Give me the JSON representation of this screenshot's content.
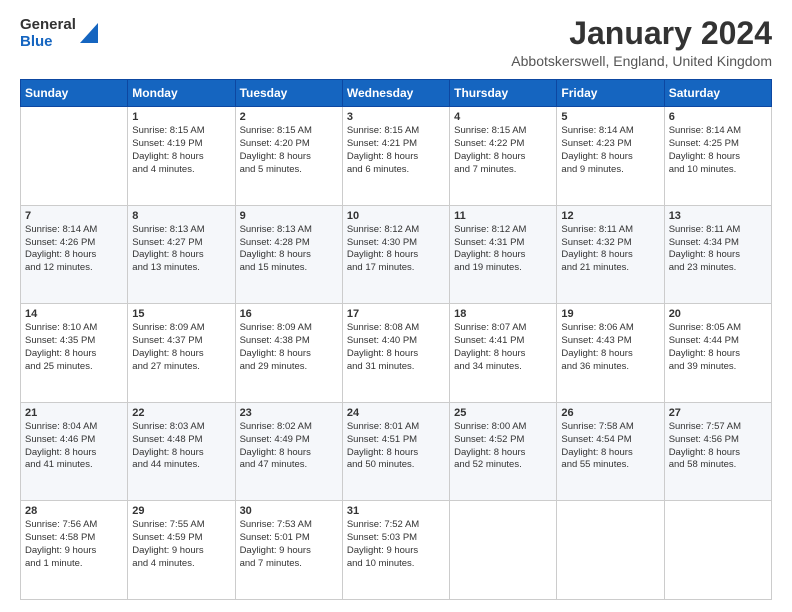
{
  "logo": {
    "line1": "General",
    "line2": "Blue"
  },
  "header": {
    "title": "January 2024",
    "subtitle": "Abbotskerswell, England, United Kingdom"
  },
  "weekdays": [
    "Sunday",
    "Monday",
    "Tuesday",
    "Wednesday",
    "Thursday",
    "Friday",
    "Saturday"
  ],
  "weeks": [
    [
      {
        "day": "",
        "lines": []
      },
      {
        "day": "1",
        "lines": [
          "Sunrise: 8:15 AM",
          "Sunset: 4:19 PM",
          "Daylight: 8 hours",
          "and 4 minutes."
        ]
      },
      {
        "day": "2",
        "lines": [
          "Sunrise: 8:15 AM",
          "Sunset: 4:20 PM",
          "Daylight: 8 hours",
          "and 5 minutes."
        ]
      },
      {
        "day": "3",
        "lines": [
          "Sunrise: 8:15 AM",
          "Sunset: 4:21 PM",
          "Daylight: 8 hours",
          "and 6 minutes."
        ]
      },
      {
        "day": "4",
        "lines": [
          "Sunrise: 8:15 AM",
          "Sunset: 4:22 PM",
          "Daylight: 8 hours",
          "and 7 minutes."
        ]
      },
      {
        "day": "5",
        "lines": [
          "Sunrise: 8:14 AM",
          "Sunset: 4:23 PM",
          "Daylight: 8 hours",
          "and 9 minutes."
        ]
      },
      {
        "day": "6",
        "lines": [
          "Sunrise: 8:14 AM",
          "Sunset: 4:25 PM",
          "Daylight: 8 hours",
          "and 10 minutes."
        ]
      }
    ],
    [
      {
        "day": "7",
        "lines": [
          "Sunrise: 8:14 AM",
          "Sunset: 4:26 PM",
          "Daylight: 8 hours",
          "and 12 minutes."
        ]
      },
      {
        "day": "8",
        "lines": [
          "Sunrise: 8:13 AM",
          "Sunset: 4:27 PM",
          "Daylight: 8 hours",
          "and 13 minutes."
        ]
      },
      {
        "day": "9",
        "lines": [
          "Sunrise: 8:13 AM",
          "Sunset: 4:28 PM",
          "Daylight: 8 hours",
          "and 15 minutes."
        ]
      },
      {
        "day": "10",
        "lines": [
          "Sunrise: 8:12 AM",
          "Sunset: 4:30 PM",
          "Daylight: 8 hours",
          "and 17 minutes."
        ]
      },
      {
        "day": "11",
        "lines": [
          "Sunrise: 8:12 AM",
          "Sunset: 4:31 PM",
          "Daylight: 8 hours",
          "and 19 minutes."
        ]
      },
      {
        "day": "12",
        "lines": [
          "Sunrise: 8:11 AM",
          "Sunset: 4:32 PM",
          "Daylight: 8 hours",
          "and 21 minutes."
        ]
      },
      {
        "day": "13",
        "lines": [
          "Sunrise: 8:11 AM",
          "Sunset: 4:34 PM",
          "Daylight: 8 hours",
          "and 23 minutes."
        ]
      }
    ],
    [
      {
        "day": "14",
        "lines": [
          "Sunrise: 8:10 AM",
          "Sunset: 4:35 PM",
          "Daylight: 8 hours",
          "and 25 minutes."
        ]
      },
      {
        "day": "15",
        "lines": [
          "Sunrise: 8:09 AM",
          "Sunset: 4:37 PM",
          "Daylight: 8 hours",
          "and 27 minutes."
        ]
      },
      {
        "day": "16",
        "lines": [
          "Sunrise: 8:09 AM",
          "Sunset: 4:38 PM",
          "Daylight: 8 hours",
          "and 29 minutes."
        ]
      },
      {
        "day": "17",
        "lines": [
          "Sunrise: 8:08 AM",
          "Sunset: 4:40 PM",
          "Daylight: 8 hours",
          "and 31 minutes."
        ]
      },
      {
        "day": "18",
        "lines": [
          "Sunrise: 8:07 AM",
          "Sunset: 4:41 PM",
          "Daylight: 8 hours",
          "and 34 minutes."
        ]
      },
      {
        "day": "19",
        "lines": [
          "Sunrise: 8:06 AM",
          "Sunset: 4:43 PM",
          "Daylight: 8 hours",
          "and 36 minutes."
        ]
      },
      {
        "day": "20",
        "lines": [
          "Sunrise: 8:05 AM",
          "Sunset: 4:44 PM",
          "Daylight: 8 hours",
          "and 39 minutes."
        ]
      }
    ],
    [
      {
        "day": "21",
        "lines": [
          "Sunrise: 8:04 AM",
          "Sunset: 4:46 PM",
          "Daylight: 8 hours",
          "and 41 minutes."
        ]
      },
      {
        "day": "22",
        "lines": [
          "Sunrise: 8:03 AM",
          "Sunset: 4:48 PM",
          "Daylight: 8 hours",
          "and 44 minutes."
        ]
      },
      {
        "day": "23",
        "lines": [
          "Sunrise: 8:02 AM",
          "Sunset: 4:49 PM",
          "Daylight: 8 hours",
          "and 47 minutes."
        ]
      },
      {
        "day": "24",
        "lines": [
          "Sunrise: 8:01 AM",
          "Sunset: 4:51 PM",
          "Daylight: 8 hours",
          "and 50 minutes."
        ]
      },
      {
        "day": "25",
        "lines": [
          "Sunrise: 8:00 AM",
          "Sunset: 4:52 PM",
          "Daylight: 8 hours",
          "and 52 minutes."
        ]
      },
      {
        "day": "26",
        "lines": [
          "Sunrise: 7:58 AM",
          "Sunset: 4:54 PM",
          "Daylight: 8 hours",
          "and 55 minutes."
        ]
      },
      {
        "day": "27",
        "lines": [
          "Sunrise: 7:57 AM",
          "Sunset: 4:56 PM",
          "Daylight: 8 hours",
          "and 58 minutes."
        ]
      }
    ],
    [
      {
        "day": "28",
        "lines": [
          "Sunrise: 7:56 AM",
          "Sunset: 4:58 PM",
          "Daylight: 9 hours",
          "and 1 minute."
        ]
      },
      {
        "day": "29",
        "lines": [
          "Sunrise: 7:55 AM",
          "Sunset: 4:59 PM",
          "Daylight: 9 hours",
          "and 4 minutes."
        ]
      },
      {
        "day": "30",
        "lines": [
          "Sunrise: 7:53 AM",
          "Sunset: 5:01 PM",
          "Daylight: 9 hours",
          "and 7 minutes."
        ]
      },
      {
        "day": "31",
        "lines": [
          "Sunrise: 7:52 AM",
          "Sunset: 5:03 PM",
          "Daylight: 9 hours",
          "and 10 minutes."
        ]
      },
      {
        "day": "",
        "lines": []
      },
      {
        "day": "",
        "lines": []
      },
      {
        "day": "",
        "lines": []
      }
    ]
  ]
}
